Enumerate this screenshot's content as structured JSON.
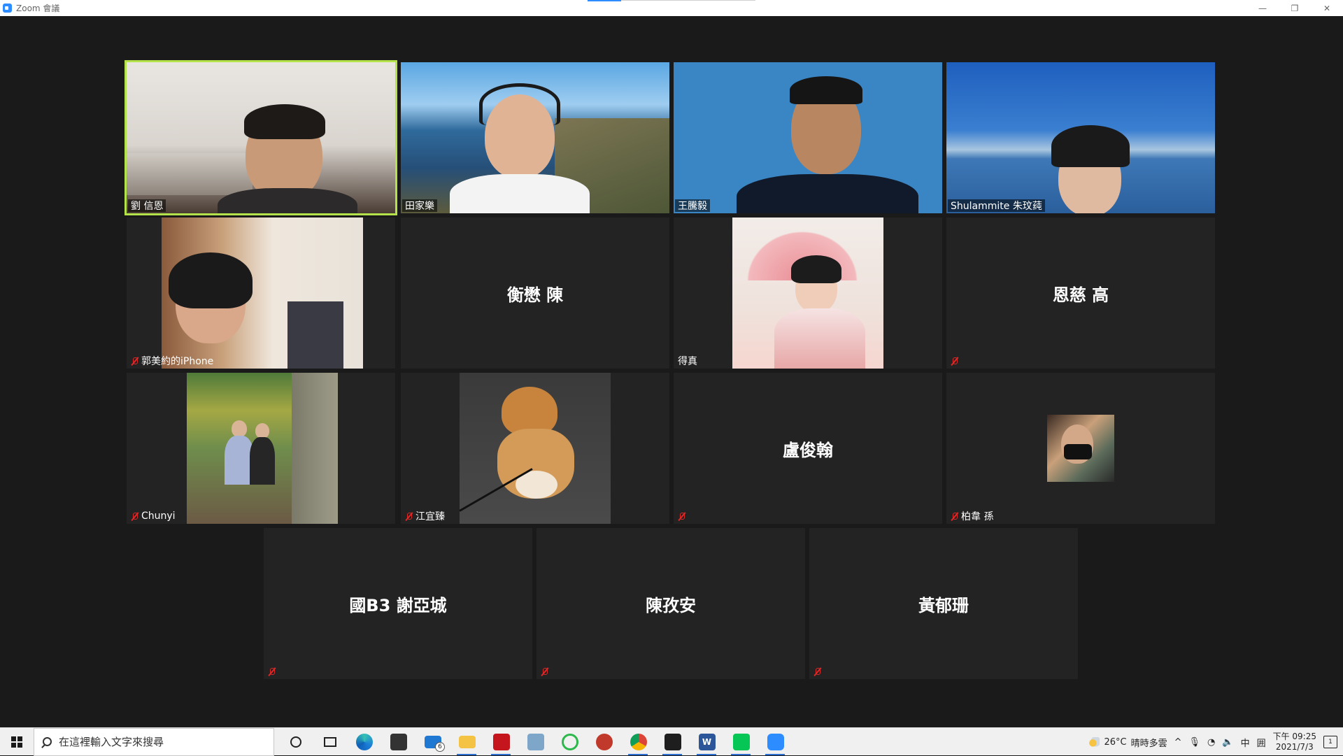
{
  "window": {
    "title": "Zoom 會議",
    "controls": {
      "minimize": "—",
      "restore": "❐",
      "close": "✕"
    }
  },
  "accent_color": "#b3e24b",
  "participants": [
    {
      "name": "劉 信恩",
      "video": true,
      "active_speaker": true,
      "muted": false
    },
    {
      "name": "田家樂",
      "video": true,
      "muted": false
    },
    {
      "name": "王騰毅",
      "video": true,
      "muted": false
    },
    {
      "name": "Shulammite 朱玟莼",
      "video": true,
      "muted": false
    },
    {
      "name": "郭美約的iPhone",
      "video": true,
      "muted": true
    },
    {
      "name": "衡懋 陳",
      "video": false,
      "muted": false
    },
    {
      "name": "得真",
      "video": true,
      "muted": false
    },
    {
      "name": "恩慈 高",
      "video": false,
      "muted": true
    },
    {
      "name": "Chunyi",
      "video": true,
      "muted": true
    },
    {
      "name": "江宜臻",
      "video": true,
      "muted": true
    },
    {
      "name": "盧俊翰",
      "video": false,
      "muted": true
    },
    {
      "name": "柏韋 孫",
      "video": true,
      "muted": true
    },
    {
      "name": "國B3 謝亞城",
      "video": false,
      "muted": true
    },
    {
      "name": "陳孜安",
      "video": false,
      "muted": true
    },
    {
      "name": "黃郁珊",
      "video": false,
      "muted": true
    }
  ],
  "taskbar": {
    "search_placeholder": "在這裡輸入文字來搜尋",
    "apps": [
      {
        "icon": "cortana-icon"
      },
      {
        "icon": "task-view-icon"
      },
      {
        "icon": "edge-icon"
      },
      {
        "icon": "store-icon"
      },
      {
        "icon": "mail-icon",
        "badge": "6"
      },
      {
        "icon": "file-explorer-icon"
      },
      {
        "icon": "acrobat-icon"
      },
      {
        "icon": "notes-icon"
      },
      {
        "icon": "green-circle-icon"
      },
      {
        "icon": "ladybug-icon"
      },
      {
        "icon": "chrome-icon"
      },
      {
        "icon": "terminal-icon"
      },
      {
        "icon": "word-icon"
      },
      {
        "icon": "line-icon"
      },
      {
        "icon": "zoom-icon"
      }
    ],
    "tray": {
      "temperature": "26°C",
      "weather": "晴時多雲",
      "chevron": "^",
      "ime": "中",
      "ime_mode": "囲",
      "time": "下午 09:25",
      "date": "2021/7/3",
      "notification_count": "1"
    }
  }
}
